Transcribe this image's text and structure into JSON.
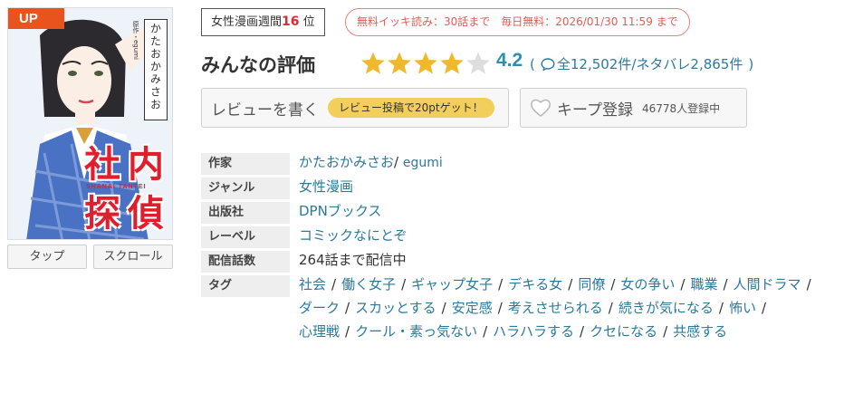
{
  "cover": {
    "badge": "UP",
    "author_vertical": "かたおかみさお",
    "credit_vertical": "原作・egumi",
    "logo_chars": [
      "社",
      "内",
      "探",
      "偵"
    ],
    "logo_romaji": "SHANAI TANTEI"
  },
  "viewer": {
    "tap_label": "タップ",
    "scroll_label": "スクロール"
  },
  "ranking": {
    "prefix": "女性漫画週間",
    "rank": "16",
    "suffix": "位"
  },
  "free": {
    "text": "無料イッキ読み：30話まで　毎日無料：2026/01/30 11:59 まで"
  },
  "rating": {
    "title": "みんなの評価",
    "score": "4.2",
    "stars_filled": 4,
    "stars_total": 5,
    "review_text_before": "(",
    "review_count": "全12,502件",
    "spoiler_count": "/ネタバレ2,865件",
    "review_text_after": ")"
  },
  "actions": {
    "review_label": "レビューを書く",
    "review_reward": "レビュー投稿で20ptゲット！",
    "keep_label": "キープ登録",
    "keep_count": "46778人登録中"
  },
  "info": {
    "author_label": "作家",
    "author_main": "かたおかみさお",
    "author_sep": "/",
    "author_sub": "egumi",
    "genre_label": "ジャンル",
    "genre": "女性漫画",
    "publisher_label": "出版社",
    "publisher": "DPNブックス",
    "label_label": "レーベル",
    "label": "コミックなにとぞ",
    "episodes_label": "配信話数",
    "episodes": "264話まで配信中",
    "tags_label": "タグ",
    "tags": [
      "社会",
      "働く女子",
      "ギャップ女子",
      "デキる女",
      "同僚",
      "女の争い",
      "職業",
      "人間ドラマ",
      "ダーク",
      "スカッとする",
      "安定感",
      "考えさせられる",
      "続きが気になる",
      "怖い",
      "心理戦",
      "クール・素っ気ない",
      "ハラハラする",
      "クセになる",
      "共感する"
    ]
  },
  "colors": {
    "accent_blue": "#2b7a9c",
    "score_blue": "#2b8fb5",
    "star_gold": "#f0b92a",
    "star_empty": "#dddddd",
    "badge_orange": "#e8531e",
    "free_red": "#e65b52",
    "reward_yellow": "#f2cf5a"
  }
}
